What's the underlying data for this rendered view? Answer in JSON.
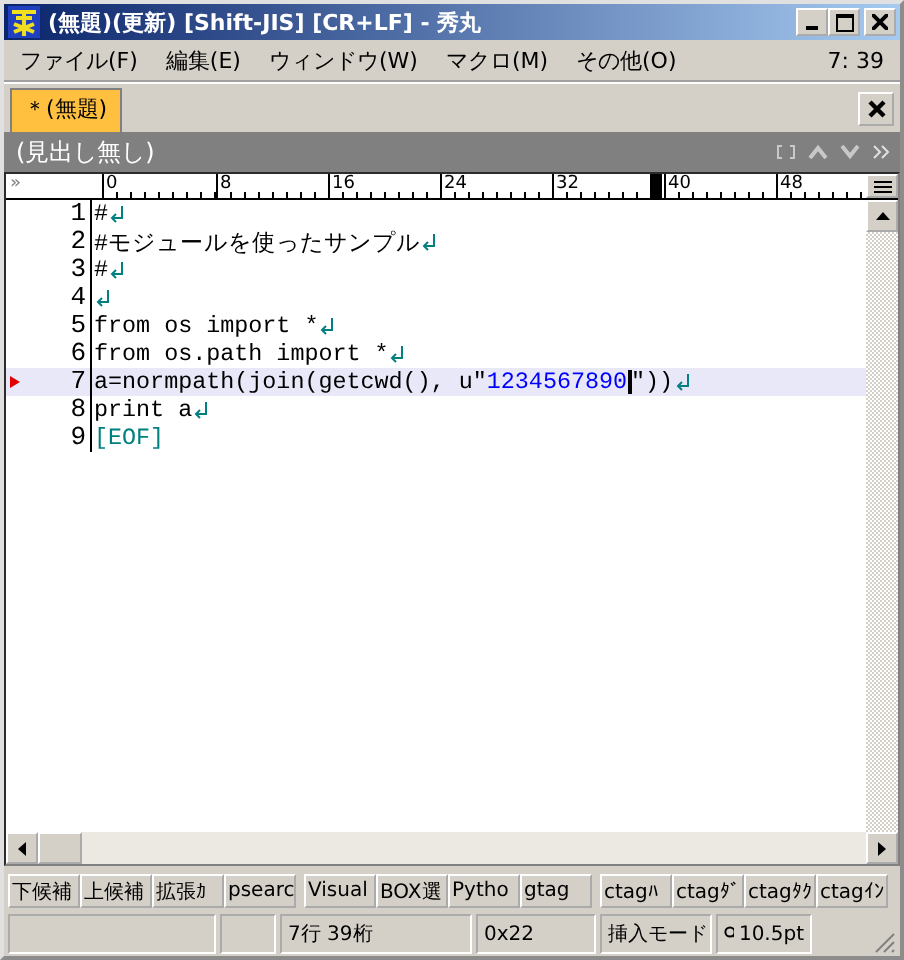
{
  "window": {
    "title": "(無題)(更新) [Shift-JIS] [CR+LF] - 秀丸"
  },
  "menu": [
    {
      "label": "ファイル(F)"
    },
    {
      "label": "編集(E)"
    },
    {
      "label": "ウィンドウ(W)"
    },
    {
      "label": "マクロ(M)"
    },
    {
      "label": "その他(O)"
    }
  ],
  "clock": "7: 39",
  "tabs": [
    {
      "label": "＊(無題)",
      "selected": true
    }
  ],
  "header": {
    "title": "(見出し無し)",
    "left_mark": "»"
  },
  "ruler": {
    "labels": [
      "0",
      "8",
      "16",
      "24",
      "32",
      "40",
      "48"
    ]
  },
  "lines": [
    {
      "number": "1",
      "current": false,
      "eol": true,
      "segments": [
        {
          "kind": "code",
          "text": "#"
        }
      ]
    },
    {
      "number": "2",
      "current": false,
      "eol": true,
      "segments": [
        {
          "kind": "code",
          "text": "#モジュールを使ったサンプル"
        }
      ]
    },
    {
      "number": "3",
      "current": false,
      "eol": true,
      "segments": [
        {
          "kind": "code",
          "text": "#"
        }
      ]
    },
    {
      "number": "4",
      "current": false,
      "eol": true
    },
    {
      "number": "5",
      "current": false,
      "eol": true,
      "segments": [
        {
          "kind": "code",
          "text": "from os import *"
        }
      ]
    },
    {
      "number": "6",
      "current": false,
      "eol": true,
      "segments": [
        {
          "kind": "code",
          "text": "from os.path import *"
        }
      ]
    },
    {
      "number": "7",
      "current": true,
      "eol": true,
      "segments": [
        {
          "kind": "code",
          "text": "a=normpath(join(getcwd(), u\""
        },
        {
          "kind": "string",
          "text": "1234567890"
        },
        {
          "kind": "code",
          "text": "\"))",
          "cursor_before": true
        }
      ]
    },
    {
      "number": "8",
      "current": false,
      "eol": true,
      "segments": [
        {
          "kind": "code",
          "text": "print a"
        }
      ]
    },
    {
      "number": "9",
      "current": false,
      "eol": false,
      "segments": [
        {
          "kind": "eof",
          "text": "[EOF]"
        }
      ]
    }
  ],
  "function_keys": [
    [
      "下候補",
      "上候補",
      "拡張ｶ",
      "psearc"
    ],
    [
      "Visual",
      "BOX選",
      "Pytho",
      "gtag"
    ],
    [
      "ctagﾊ",
      "ctagﾀﾞ",
      "ctagﾀｸ",
      "ctagｲﾝ"
    ]
  ],
  "status_bar": {
    "position": "7行 39桁",
    "code": "0x22",
    "mode": "挿入モード",
    "zoom": "10.5pt"
  }
}
